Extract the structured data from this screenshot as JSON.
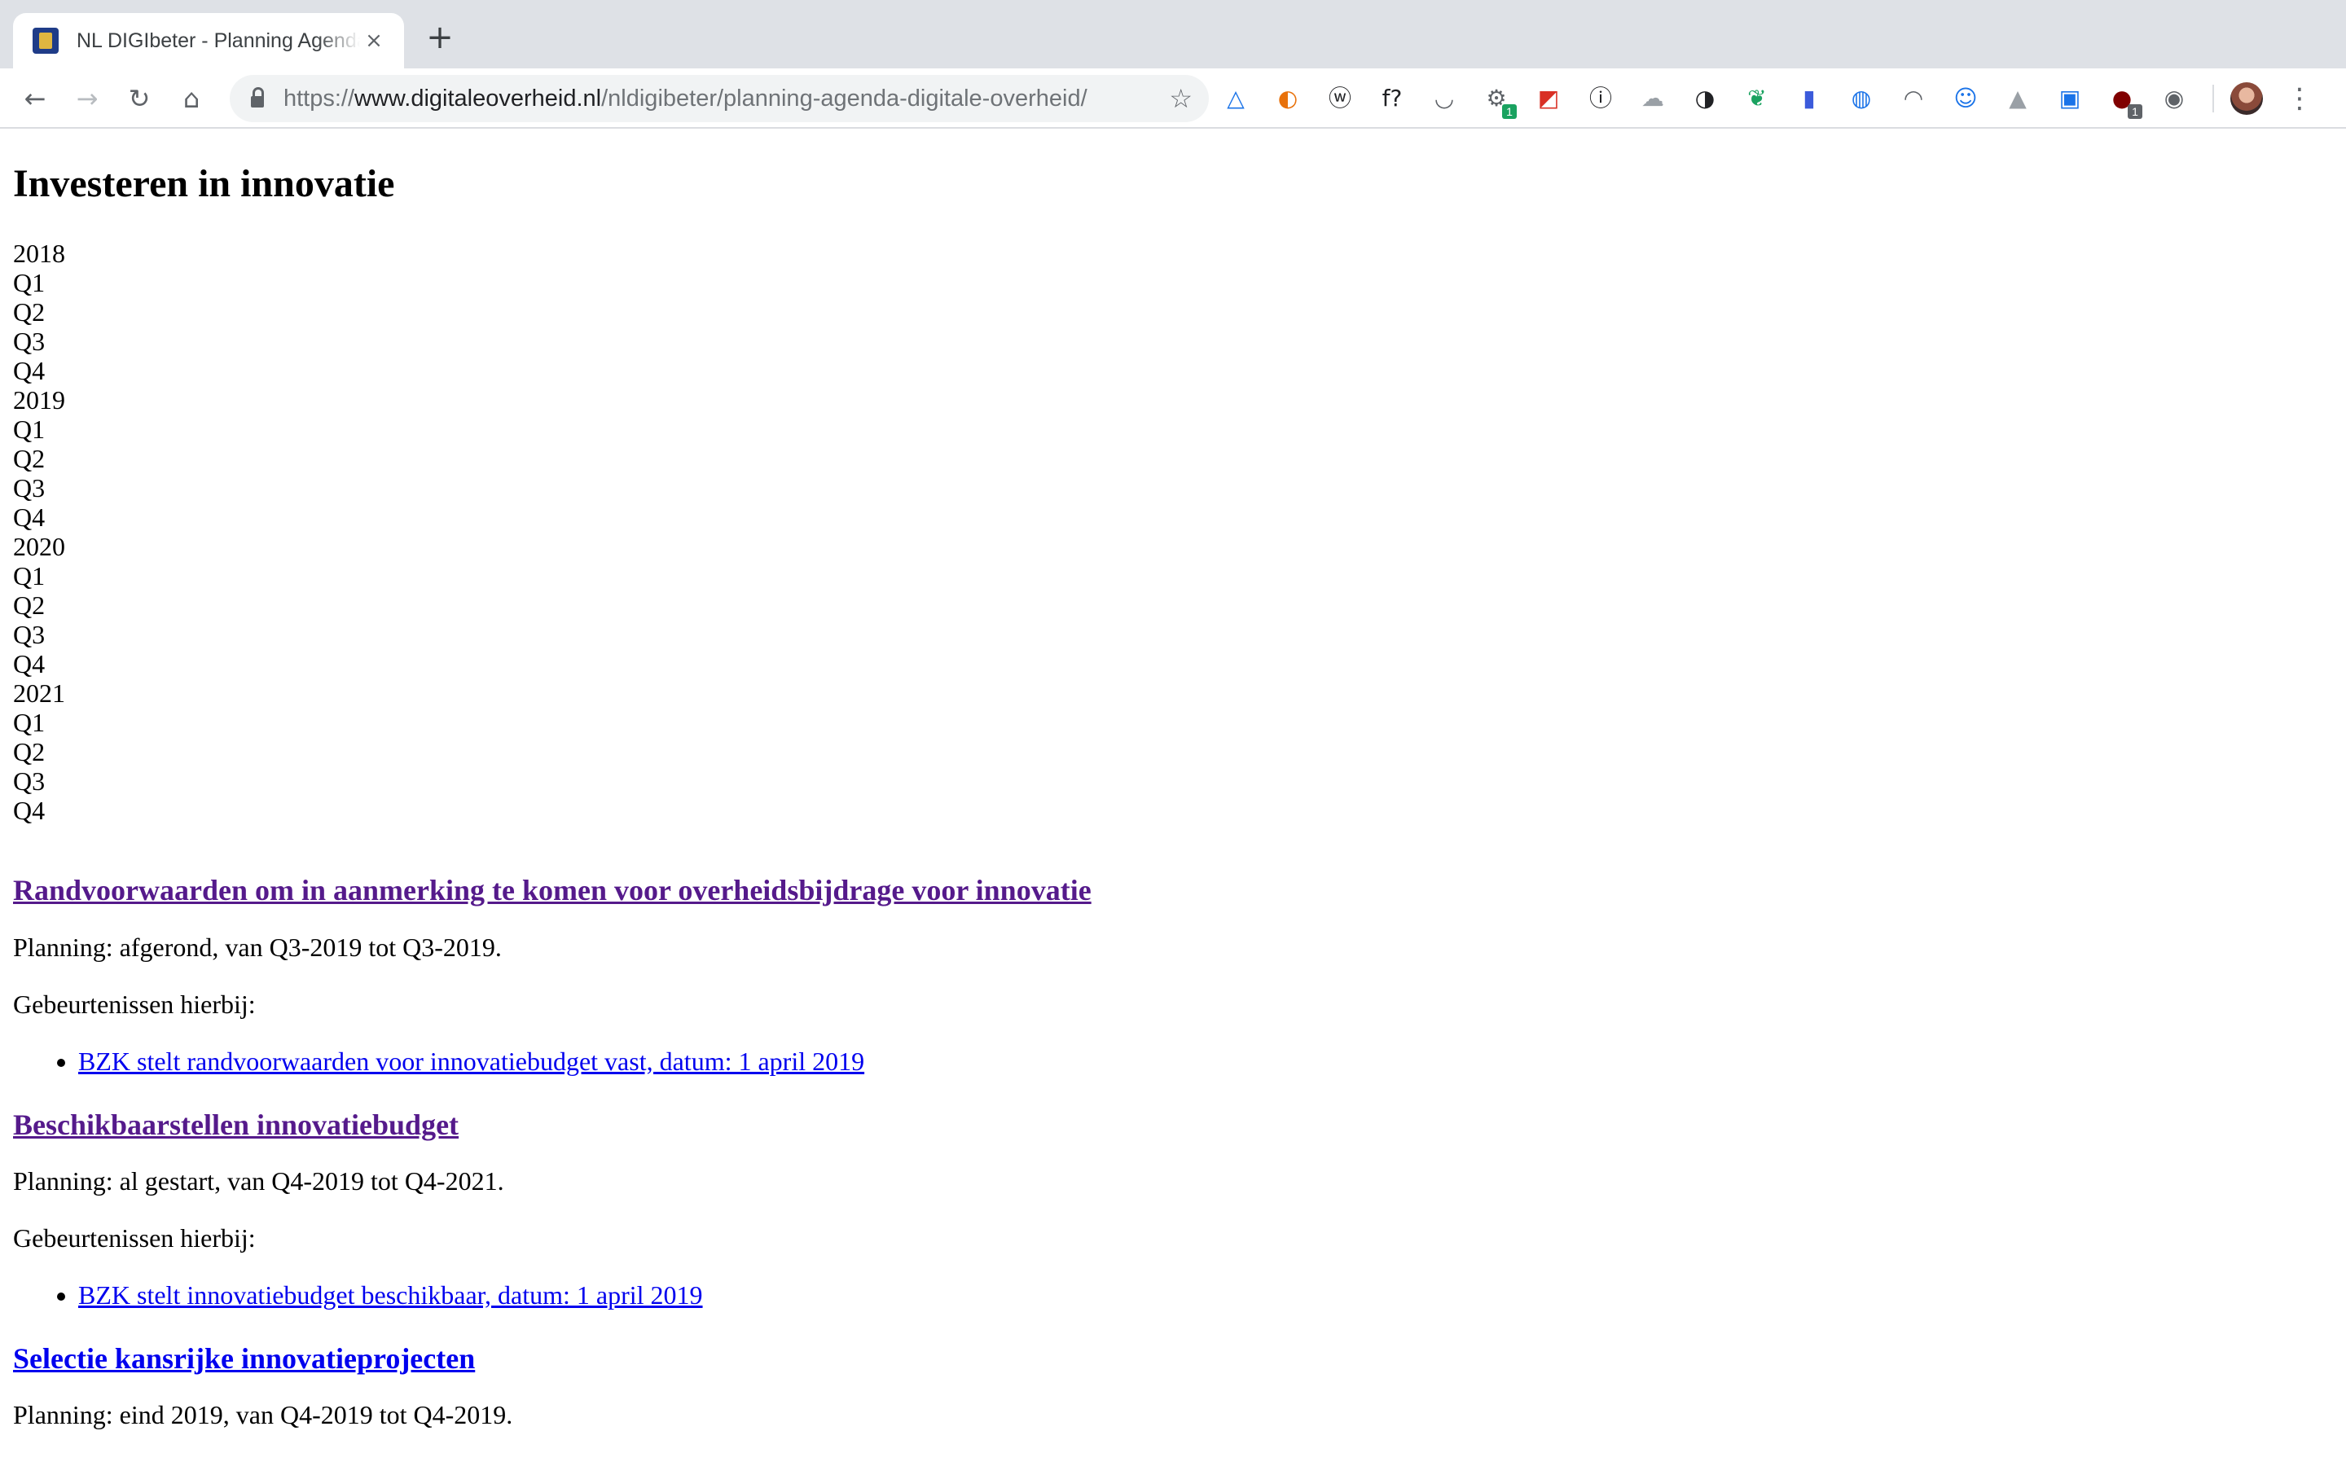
{
  "browser": {
    "tab": {
      "title": "NL DIGIbeter - Planning Agenda Digitale Overheid"
    },
    "address": {
      "scheme": "https://",
      "host": "www.digitaleoverheid.nl",
      "path": "/nldigibeter/planning-agenda-digitale-overheid/"
    },
    "icons": {
      "back": "←",
      "forward": "→",
      "reload": "↻",
      "home": "⌂",
      "star": "☆",
      "close": "×",
      "new_tab": "+",
      "menu": "⋮"
    },
    "extensions": [
      {
        "name": "triangle-extension-icon",
        "glyph": "△",
        "color": "#1a73e8"
      },
      {
        "name": "flame-extension-icon",
        "glyph": "◐",
        "color": "#e8710a"
      },
      {
        "name": "w-extension-icon",
        "glyph": "ⓦ",
        "color": "#202124"
      },
      {
        "name": "fquestion-extension-icon",
        "glyph": "f?",
        "color": "#202124"
      },
      {
        "name": "pocket-extension-icon",
        "glyph": "◡",
        "color": "#5f6368"
      },
      {
        "name": "gear-extension-icon",
        "glyph": "⚙",
        "color": "#5f6368",
        "badge": "1",
        "badge_color": "#1aa260"
      },
      {
        "name": "flag-extension-icon",
        "glyph": "◩",
        "color": "#d93025"
      },
      {
        "name": "info-extension-icon",
        "glyph": "ⓘ",
        "color": "#202124"
      },
      {
        "name": "cloud-extension-icon",
        "glyph": "☁",
        "color": "#9aa0a6"
      },
      {
        "name": "contrast-extension-icon",
        "glyph": "◑",
        "color": "#202124"
      },
      {
        "name": "evernote-extension-icon",
        "glyph": "❦",
        "color": "#1aa260"
      },
      {
        "name": "lighthouse-extension-icon",
        "glyph": "▮",
        "color": "#3b5bdb"
      },
      {
        "name": "compass-extension-icon",
        "glyph": "◍",
        "color": "#1a73e8"
      },
      {
        "name": "speedometer-extension-icon",
        "glyph": "◠",
        "color": "#5f6368"
      },
      {
        "name": "ghost-extension-icon",
        "glyph": "☺",
        "color": "#1a73e8"
      },
      {
        "name": "drive-extension-icon",
        "glyph": "▲",
        "color": "#9aa0a6"
      },
      {
        "name": "window-extension-icon",
        "glyph": "▣",
        "color": "#1a73e8"
      },
      {
        "name": "ublock-extension-icon",
        "glyph": "●",
        "color": "#800000",
        "badge": "1",
        "badge_color": "#5f6368"
      },
      {
        "name": "eye-extension-icon",
        "glyph": "◉",
        "color": "#5f6368"
      }
    ]
  },
  "page": {
    "title": "Investeren in innovatie",
    "timeline": [
      "2018",
      "Q1",
      "Q2",
      "Q3",
      "Q4",
      "2019",
      "Q1",
      "Q2",
      "Q3",
      "Q4",
      "2020",
      "Q1",
      "Q2",
      "Q3",
      "Q4",
      "2021",
      "Q1",
      "Q2",
      "Q3",
      "Q4"
    ],
    "sections": [
      {
        "heading": "Randvoorwaarden om in aanmerking te komen voor overheidsbijdrage voor innovatie",
        "planning": "Planning: afgerond, van Q3-2019 tot Q3-2019.",
        "events_label": "Gebeurtenissen hierbij:",
        "event": "BZK stelt randvoorwaarden voor innovatiebudget vast, datum: 1 april 2019"
      },
      {
        "heading": "Beschikbaarstellen innovatiebudget",
        "planning": "Planning: al gestart, van Q4-2019 tot Q4-2021.",
        "events_label": "Gebeurtenissen hierbij:",
        "event": "BZK stelt innovatiebudget beschikbaar, datum: 1 april 2019"
      },
      {
        "heading": "Selectie kansrijke innovatieprojecten",
        "planning": "Planning: eind 2019, van Q4-2019 tot Q4-2019."
      }
    ]
  }
}
